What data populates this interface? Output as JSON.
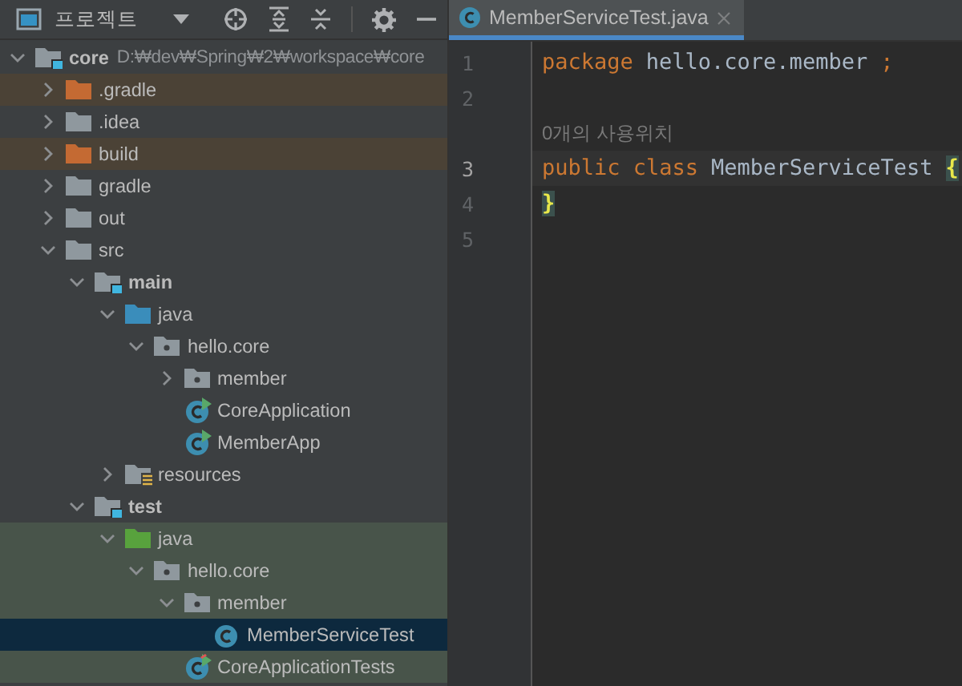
{
  "project_panel": {
    "title": "프로젝트"
  },
  "tree": [
    {
      "label": "core",
      "path": "D:₩dev₩Spring₩2₩workspace₩core",
      "kind": "module",
      "expanded": true,
      "selected": false,
      "children": [
        {
          "label": ".gradle",
          "kind": "excluded",
          "expanded": false,
          "selected": false
        },
        {
          "label": ".idea",
          "kind": "folder",
          "expanded": false,
          "selected": false
        },
        {
          "label": "build",
          "kind": "excluded",
          "expanded": false,
          "selected": false
        },
        {
          "label": "gradle",
          "kind": "folder",
          "expanded": false,
          "selected": false
        },
        {
          "label": "out",
          "kind": "folder",
          "expanded": false,
          "selected": false
        },
        {
          "label": "src",
          "kind": "folder",
          "expanded": true,
          "selected": false,
          "children": [
            {
              "label": "main",
              "kind": "module",
              "expanded": true,
              "selected": false,
              "children": [
                {
                  "label": "java",
                  "kind": "source",
                  "expanded": true,
                  "selected": false,
                  "children": [
                    {
                      "label": "hello.core",
                      "kind": "package",
                      "expanded": true,
                      "selected": false,
                      "children": [
                        {
                          "label": "member",
                          "kind": "package",
                          "expanded": false,
                          "selected": false
                        },
                        {
                          "label": "CoreApplication",
                          "kind": "app-class",
                          "selected": false
                        },
                        {
                          "label": "MemberApp",
                          "kind": "app-class",
                          "selected": false
                        }
                      ]
                    }
                  ]
                },
                {
                  "label": "resources",
                  "kind": "resources",
                  "expanded": false,
                  "selected": false
                }
              ]
            },
            {
              "label": "test",
              "kind": "module",
              "expanded": true,
              "selected": false,
              "children": [
                {
                  "label": "java",
                  "kind": "test-source",
                  "expanded": true,
                  "selected": false,
                  "children": [
                    {
                      "label": "hello.core",
                      "kind": "package",
                      "expanded": true,
                      "selected": false,
                      "children": [
                        {
                          "label": "member",
                          "kind": "package",
                          "expanded": true,
                          "selected": false,
                          "children": [
                            {
                              "label": "MemberServiceTest",
                              "kind": "class",
                              "selected": true
                            }
                          ]
                        },
                        {
                          "label": "CoreApplicationTests",
                          "kind": "test-class",
                          "selected": false
                        }
                      ]
                    }
                  ]
                }
              ]
            }
          ]
        }
      ]
    }
  ],
  "editor_tab": {
    "label": "MemberServiceTest.java",
    "selected": true
  },
  "code": [
    {
      "kind": "line",
      "number": "1",
      "current": false,
      "tokens": [
        {
          "kind": "keyword",
          "text": "package"
        },
        {
          "kind": "ident",
          "text": "hello.core.member"
        },
        {
          "kind": "keyword",
          "text": ";"
        }
      ]
    },
    {
      "kind": "line",
      "number": "2",
      "current": false
    },
    {
      "kind": "hint",
      "text": "0개의 사용위치"
    },
    {
      "kind": "line",
      "number": "3",
      "current": true,
      "tokens": [
        {
          "kind": "keyword",
          "text": "public class"
        },
        {
          "kind": "classname",
          "text": "MemberServiceTest"
        },
        {
          "kind": "brace",
          "text": "{"
        }
      ]
    },
    {
      "kind": "line",
      "number": "4",
      "current": false,
      "tokens": [
        {
          "kind": "brace",
          "text": "}"
        }
      ]
    },
    {
      "kind": "line",
      "number": "5",
      "current": false
    }
  ]
}
